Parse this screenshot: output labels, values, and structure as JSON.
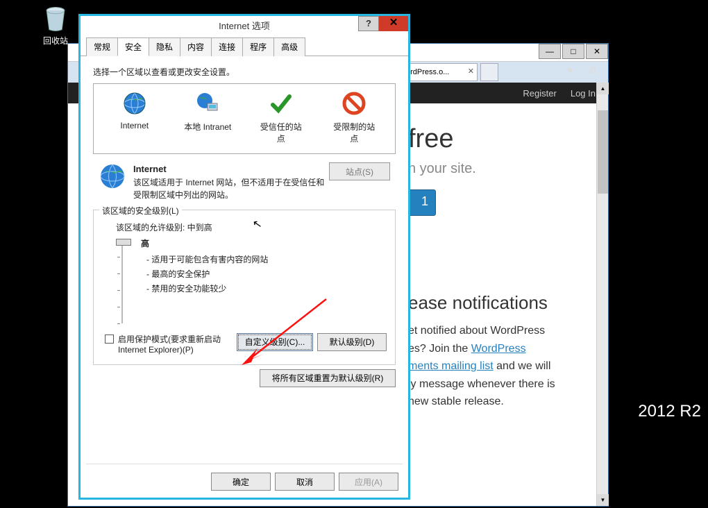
{
  "desktop": {
    "recycle_bin": "回收站"
  },
  "watermark": "2012 R2",
  "ie": {
    "tab_title": "ordPress.o...",
    "header": {
      "register": "Register",
      "login": "Log In"
    },
    "page": {
      "free": "free",
      "tagline": "n your site.",
      "btn": "1",
      "news_heading": "ease notifications",
      "news_p1": "et notified about WordPress",
      "news_p2a": "es? Join the ",
      "news_link1": "WordPress",
      "news_link2": "ments mailing list",
      "news_p3": " and we will",
      "news_p4": "ly message whenever there is",
      "news_p5": "new stable release."
    }
  },
  "dialog": {
    "title": "Internet 选项",
    "tabs": [
      "常规",
      "安全",
      "隐私",
      "内容",
      "连接",
      "程序",
      "高级"
    ],
    "zone_prompt": "选择一个区域以查看或更改安全设置。",
    "zones": {
      "internet": "Internet",
      "local": "本地 Intranet",
      "trusted": "受信任的站点",
      "restricted": "受限制的站点"
    },
    "zone_name": "Internet",
    "sites_btn": "站点(S)",
    "zone_desc": "该区域适用于 Internet 网站，但不适用于在受信任和受限制区域中列出的网站。",
    "sec_legend": "该区域的安全级别(L)",
    "allow_level": "该区域的允许级别: 中到高",
    "level_high": "高",
    "bullets": [
      "- 适用于可能包含有害内容的网站",
      "- 最高的安全保护",
      "- 禁用的安全功能较少"
    ],
    "protect_mode": "启用保护模式(要求重新启动 Internet Explorer)(P)",
    "custom_btn": "自定义级别(C)...",
    "default_btn": "默认级别(D)",
    "reset_btn": "将所有区域重置为默认级别(R)",
    "ok": "确定",
    "cancel": "取消",
    "apply": "应用(A)"
  }
}
